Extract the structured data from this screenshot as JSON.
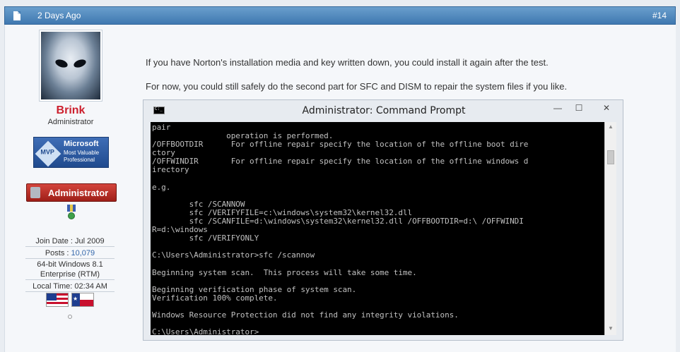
{
  "post_header": {
    "date": "2 Days Ago",
    "post_number": "#14",
    "doc_icon": "document-icon"
  },
  "user": {
    "name": "Brink",
    "title": "Administrator",
    "avatar_icon": "alien-avatar",
    "mvp_badge": {
      "line1": "Microsoft",
      "line2": "Most Valuable",
      "line3": "Professional",
      "emblem": "MVP"
    },
    "admin_badge_label": "Administrator",
    "award_icon": "medal-icon",
    "join_date_label": "Join Date : Jul 2009",
    "posts_label": "Posts : ",
    "posts_value": "10,079",
    "os_line1": "64-bit Windows 8.1",
    "os_line2": "Enterprise (RTM)",
    "local_time_label": "Local Time: 02:34 AM",
    "flags": [
      "us-flag-icon",
      "texas-flag-icon"
    ],
    "status_icon": "offline-status-icon"
  },
  "message": {
    "line1": "If you have Norton's installation media and key written down, you could install it again after the test.",
    "line2": "For now, you could still safely do the second part for SFC and DISM to repair the system files if you like."
  },
  "cmd_window": {
    "title": "Administrator: Command Prompt",
    "minimize": "—",
    "maximize": "☐",
    "close": "✕",
    "console_text": "pair\n                operation is performed.\n/OFFBOOTDIR      For offline repair specify the location of the offline boot dire\nctory\n/OFFWINDIR       For offline repair specify the location of the offline windows d\nirectory\n\ne.g.\n\n        sfc /SCANNOW\n        sfc /VERIFYFILE=c:\\windows\\system32\\kernel32.dll\n        sfc /SCANFILE=d:\\windows\\system32\\kernel32.dll /OFFBOOTDIR=d:\\ /OFFWINDI\nR=d:\\windows\n        sfc /VERIFYONLY\n\nC:\\Users\\Administrator>sfc /scannow\n\nBeginning system scan.  This process will take some time.\n\nBeginning verification phase of system scan.\nVerification 100% complete.\n\nWindows Resource Protection did not find any integrity violations.\n\nC:\\Users\\Administrator>"
  }
}
